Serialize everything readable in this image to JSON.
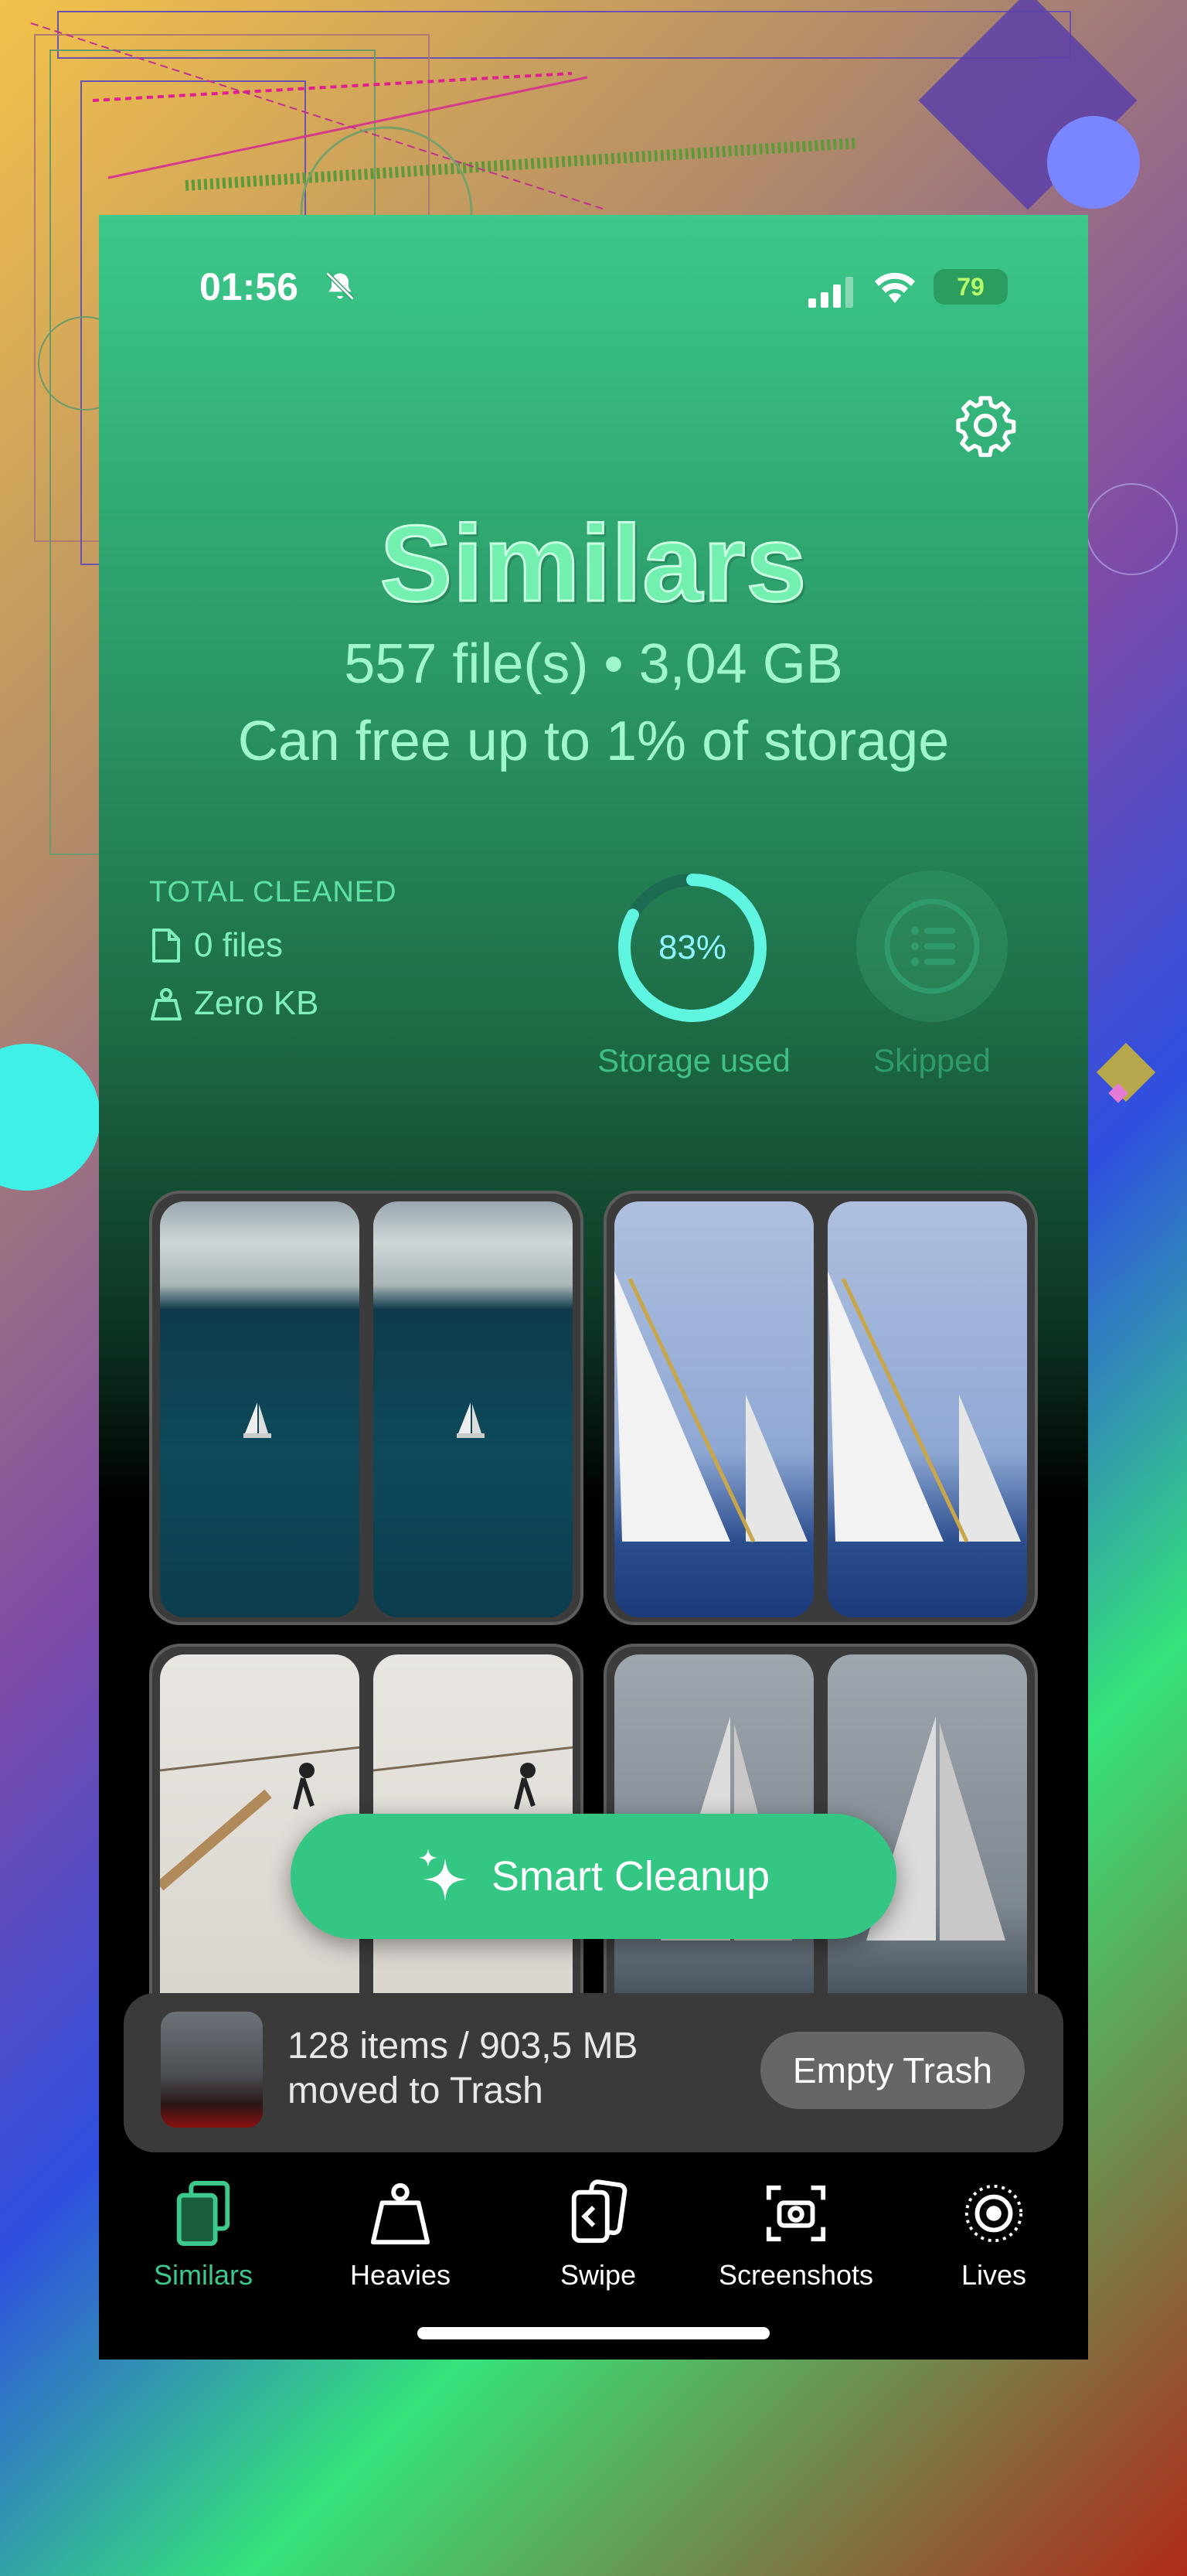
{
  "status_bar": {
    "time": "01:56",
    "battery": "79"
  },
  "header": {
    "title": "Similars",
    "summary": "557 file(s) • 3,04 GB",
    "free_up": "Can free up to 1% of storage"
  },
  "stats": {
    "total_cleaned_label": "TOTAL CLEANED",
    "files": "0 files",
    "size": "Zero KB",
    "storage_percent": "83%",
    "storage_fraction": 0.83,
    "storage_label": "Storage used",
    "skipped_label": "Skipped"
  },
  "smart_cleanup": {
    "label": "Smart Cleanup"
  },
  "trash": {
    "line1": "128 items / 903,5 MB",
    "line2": "moved to Trash",
    "button": "Empty Trash"
  },
  "tabs": [
    {
      "label": "Similars",
      "icon": "similars-icon",
      "active": true
    },
    {
      "label": "Heavies",
      "icon": "weight-icon",
      "active": false
    },
    {
      "label": "Swipe",
      "icon": "swipe-icon",
      "active": false
    },
    {
      "label": "Screenshots",
      "icon": "screenshot-icon",
      "active": false
    },
    {
      "label": "Lives",
      "icon": "live-photo-icon",
      "active": false
    }
  ],
  "colors": {
    "accent": "#3cc98b",
    "ring": "#5ff5e0",
    "title": "#73f0b0"
  }
}
